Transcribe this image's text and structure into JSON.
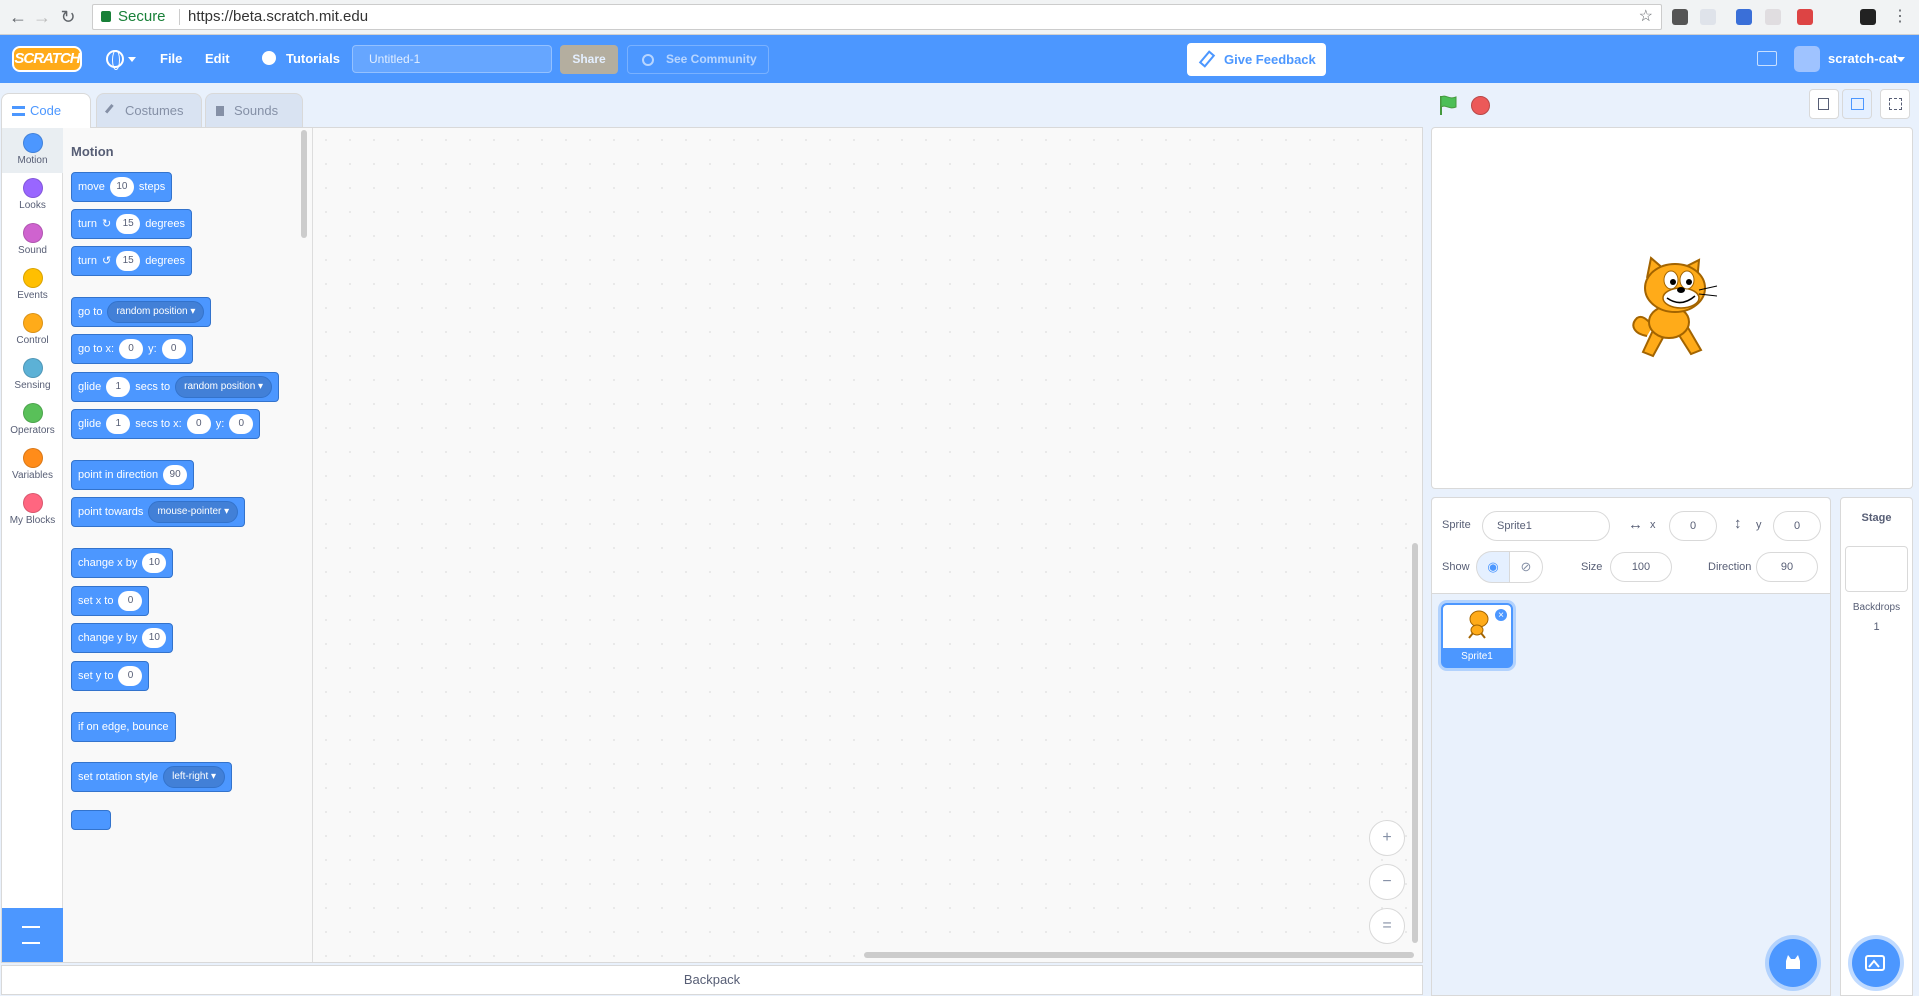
{
  "browser": {
    "secure_label": "Secure",
    "url": "https://beta.scratch.mit.edu"
  },
  "menubar": {
    "logo": "SCRATCH",
    "file": "File",
    "edit": "Edit",
    "tutorials": "Tutorials",
    "project_title": "Untitled-1",
    "share": "Share",
    "see_community": "See Community",
    "give_feedback": "Give Feedback",
    "username": "scratch-cat"
  },
  "tabs": {
    "code": "Code",
    "costumes": "Costumes",
    "sounds": "Sounds"
  },
  "categories": [
    {
      "label": "Motion",
      "color": "#4c97ff"
    },
    {
      "label": "Looks",
      "color": "#9966ff"
    },
    {
      "label": "Sound",
      "color": "#cf63cf"
    },
    {
      "label": "Events",
      "color": "#ffbf00"
    },
    {
      "label": "Control",
      "color": "#ffab19"
    },
    {
      "label": "Sensing",
      "color": "#5cb1d6"
    },
    {
      "label": "Operators",
      "color": "#59c059"
    },
    {
      "label": "Variables",
      "color": "#ff8c1a"
    },
    {
      "label": "My Blocks",
      "color": "#ff6680"
    }
  ],
  "palette": {
    "title": "Motion",
    "blocks": {
      "move": {
        "a": "move",
        "v": "10",
        "b": "steps"
      },
      "turn_right": {
        "a": "turn",
        "icon": "↻",
        "v": "15",
        "b": "degrees"
      },
      "turn_left": {
        "a": "turn",
        "icon": "↺",
        "v": "15",
        "b": "degrees"
      },
      "goto": {
        "a": "go to",
        "dd": "random position"
      },
      "goto_xy": {
        "a": "go to x:",
        "x": "0",
        "b": "y:",
        "y": "0"
      },
      "glide_to": {
        "a": "glide",
        "v": "1",
        "b": "secs to",
        "dd": "random position"
      },
      "glide_xy": {
        "a": "glide",
        "v": "1",
        "b": "secs to x:",
        "x": "0",
        "c": "y:",
        "y": "0"
      },
      "point_dir": {
        "a": "point in direction",
        "v": "90"
      },
      "point_towards": {
        "a": "point towards",
        "dd": "mouse-pointer"
      },
      "change_x": {
        "a": "change x by",
        "v": "10"
      },
      "set_x": {
        "a": "set x to",
        "v": "0"
      },
      "change_y": {
        "a": "change y by",
        "v": "10"
      },
      "set_y": {
        "a": "set y to",
        "v": "0"
      },
      "bounce": {
        "a": "if on edge, bounce"
      },
      "rotation_style": {
        "a": "set rotation style",
        "dd": "left-right"
      }
    }
  },
  "zoom": {
    "in": "+",
    "out": "−",
    "reset": "="
  },
  "backpack": "Backpack",
  "sprite_info": {
    "sprite_label": "Sprite",
    "sprite_name": "Sprite1",
    "x_label": "x",
    "x_value": "0",
    "y_label": "y",
    "y_value": "0",
    "show_label": "Show",
    "size_label": "Size",
    "size_value": "100",
    "direction_label": "Direction",
    "direction_value": "90"
  },
  "sprites": [
    {
      "name": "Sprite1"
    }
  ],
  "stage_pane": {
    "title": "Stage",
    "backdrops_label": "Backdrops",
    "backdrops_count": "1"
  }
}
